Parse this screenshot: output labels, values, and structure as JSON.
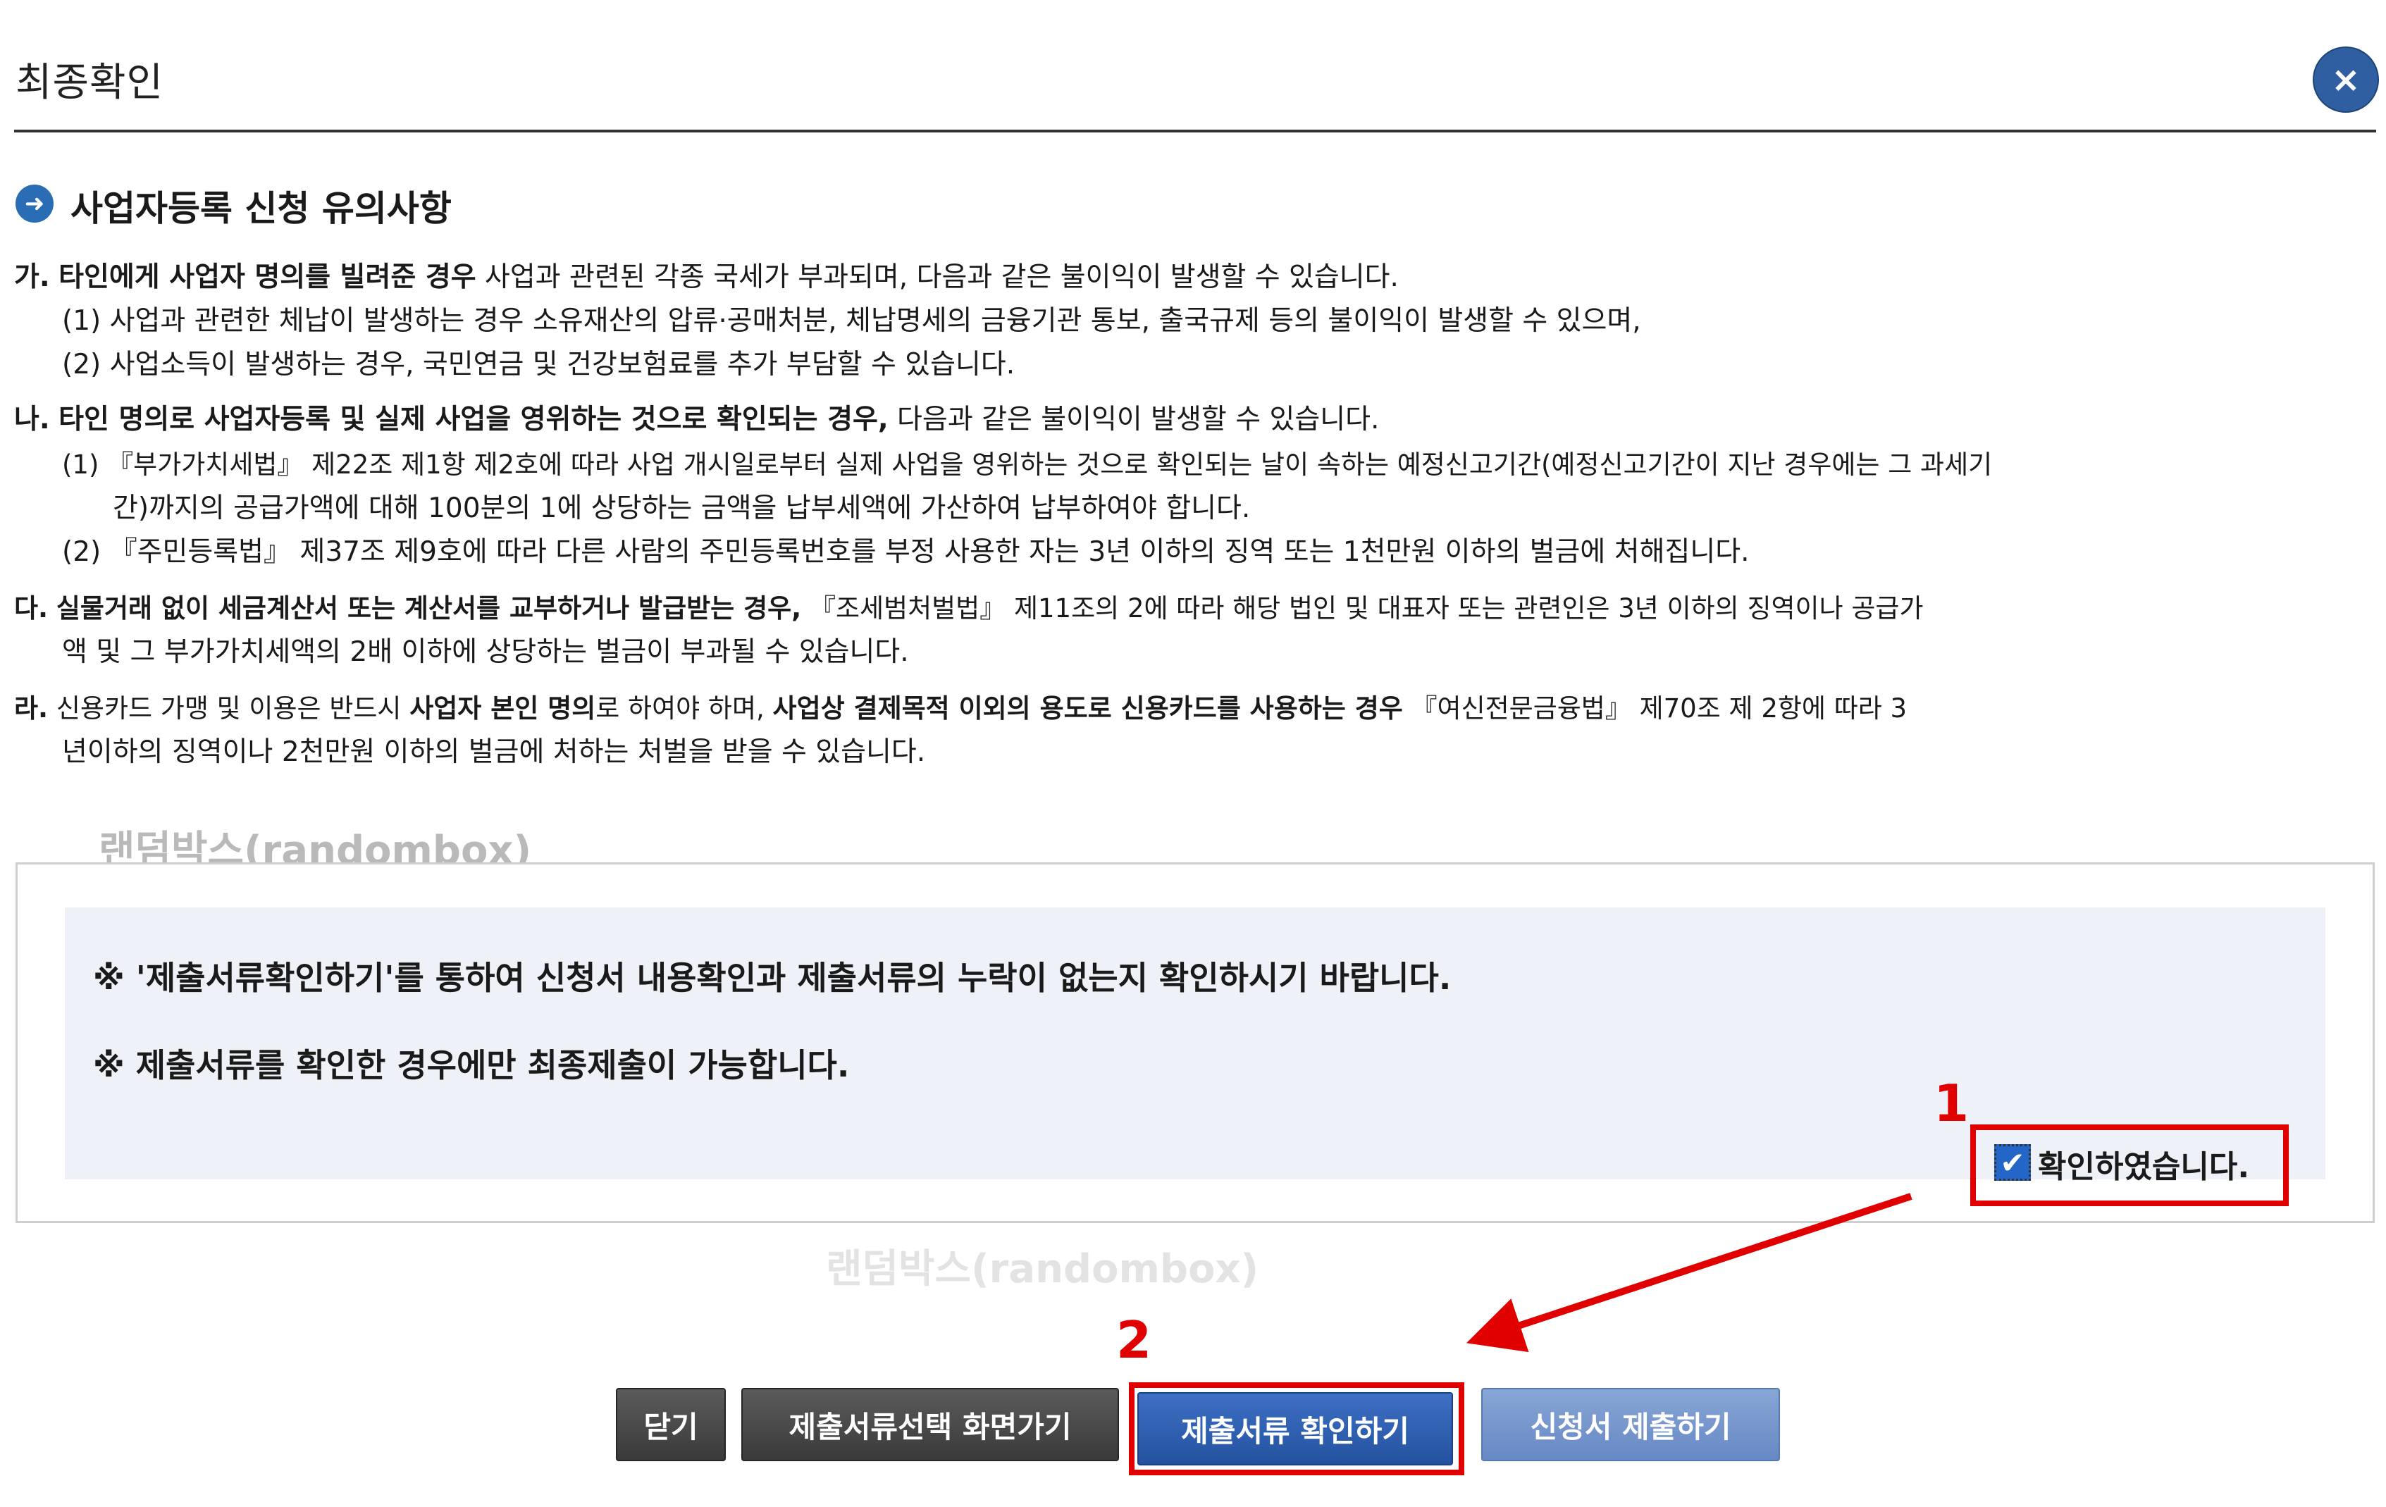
{
  "dialog": {
    "title": "최종확인",
    "close_icon": "×"
  },
  "section": {
    "icon": "➜",
    "title": "사업자등록 신청 유의사항"
  },
  "notices": {
    "ga": {
      "label": "가.",
      "bold": "타인에게 사업자 명의를 빌려준 경우",
      "text": " 사업과 관련된 각종 국세가 부과되며, 다음과 같은 불이익이 발생할 수 있습니다.",
      "sub1": "(1) 사업과 관련한 체납이 발생하는 경우 소유재산의 압류·공매처분, 체납명세의 금융기관 통보, 출국규제 등의 불이익이 발생할 수 있으며,",
      "sub2": "(2) 사업소득이 발생하는 경우, 국민연금 및 건강보험료를 추가 부담할 수 있습니다."
    },
    "na": {
      "label": "나.",
      "bold": "타인 명의로 사업자등록 및 실제 사업을 영위하는 것으로 확인되는 경우,",
      "text": " 다음과 같은 불이익이 발생할 수 있습니다.",
      "sub1": "(1) 『부가가치세법』 제22조 제1항 제2호에 따라 사업 개시일로부터 실제 사업을 영위하는 것으로 확인되는 날이 속하는 예정신고기간(예정신고기간이 지난 경우에는 그 과세기",
      "sub1_cont": "간)까지의 공급가액에 대해 100분의 1에 상당하는 금액을 납부세액에 가산하여 납부하여야 합니다.",
      "sub2": "(2) 『주민등록법』 제37조 제9호에 따라 다른 사람의 주민등록번호를 부정 사용한 자는 3년 이하의 징역 또는 1천만원 이하의 벌금에 처해집니다."
    },
    "da": {
      "label": "다.",
      "bold": "실물거래 없이 세금계산서 또는 계산서를 교부하거나 발급받는 경우,",
      "text": " 『조세범처벌법』 제11조의 2에 따라 해당 법인 및 대표자 또는 관련인은 3년 이하의 징역이나 공급가",
      "cont": "액 및 그 부가가치세액의 2배 이하에 상당하는 벌금이 부과될 수 있습니다."
    },
    "ra": {
      "label": "라.",
      "text1": " 신용카드 가맹 및 이용은 반드시 ",
      "bold1": "사업자 본인 명의",
      "text2": "로 하여야 하며, ",
      "bold2": "사업상 결제목적 이외의 용도로 신용카드를 사용하는 경우",
      "text3": " 『여신전문금융법』 제70조 제 2항에 따라 3",
      "cont": "년이하의 징역이나 2천만원 이하의 벌금에 처하는 처벌을 받을 수 있습니다."
    }
  },
  "watermarks": {
    "first": "랜덤박스(randombox)",
    "second": "랜덤박스(randombox)"
  },
  "info_box": {
    "line1": "※   '제출서류확인하기'를 통하여 신청서 내용확인과 제출서류의 누락이 없는지 확인하시기 바랍니다.",
    "line2": "※   제출서류를 확인한 경우에만 최종제출이 가능합니다."
  },
  "confirm": {
    "step_number": "1",
    "checked": true,
    "check_glyph": "✔",
    "label": "확인하였습니다."
  },
  "buttons": {
    "step_number": "2",
    "close": "닫기",
    "select_docs": "제출서류선택 화면가기",
    "verify_docs": "제출서류 확인하기",
    "submit": "신청서 제출하기"
  },
  "colors": {
    "annotation_red": "#e00000",
    "close_button": "#2f5fa0",
    "primary_button": "#24529f",
    "dark_button": "#3a3a3a",
    "disabled_button": "#6688c4",
    "info_box_bg": "#eef1f7"
  }
}
